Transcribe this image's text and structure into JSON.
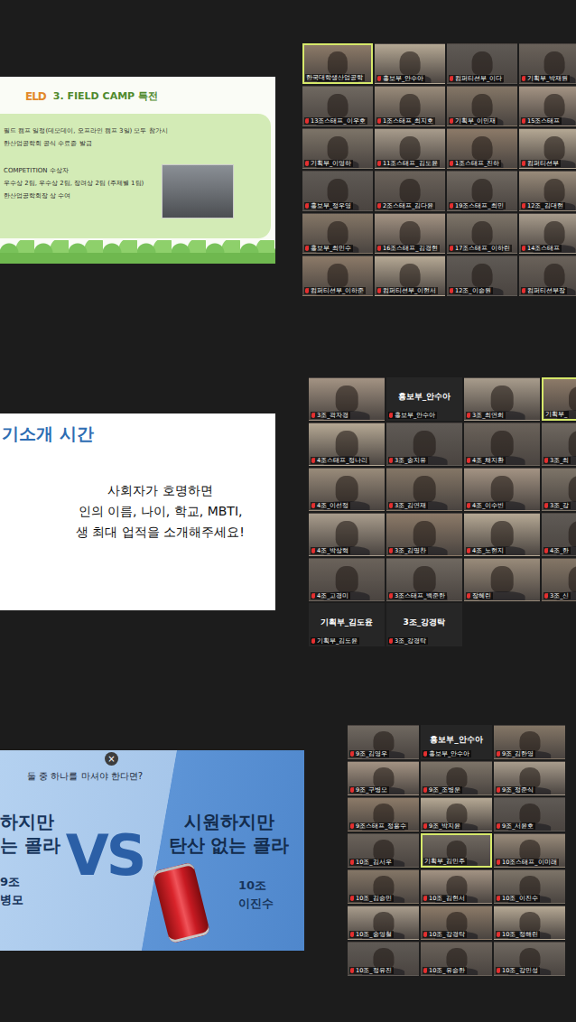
{
  "sections": [
    {
      "slide": {
        "kind": "benefits",
        "logo": "ELD",
        "title": "3. FIELD CAMP 특전",
        "lines": [
          "필드 캠프 일정(데모데이, 오프라인 캠프 3일) 모두 참가시",
          "한산업공학회 공식 수료증 발급"
        ],
        "lines2": [
          "COMPETITION 수상자",
          "우수상 2팀, 우수상 2팀, 장려상 2팀 (주제별 1팀)",
          "한산업공학회장 상 수여"
        ]
      },
      "grid": {
        "columns": 4,
        "tiles": [
          {
            "kind": "video",
            "label": "한국대학생산업공학",
            "muted": false,
            "active": true
          },
          {
            "kind": "video",
            "label": "홍보부_안수아",
            "muted": true,
            "active": false
          },
          {
            "kind": "video",
            "label": "컴퍼티션부_이다",
            "muted": true,
            "active": false
          },
          {
            "kind": "video",
            "label": "기획부_박재원",
            "muted": true,
            "active": false
          },
          {
            "kind": "video",
            "label": "13조스태프_이우호",
            "muted": true,
            "active": false
          },
          {
            "kind": "video",
            "label": "1조스태프_최지호",
            "muted": true,
            "active": false
          },
          {
            "kind": "video",
            "label": "기획부_이민재",
            "muted": true,
            "active": false
          },
          {
            "kind": "video",
            "label": "15조스태프",
            "muted": true,
            "active": false
          },
          {
            "kind": "video",
            "label": "기획부_이영하",
            "muted": true,
            "active": false
          },
          {
            "kind": "video",
            "label": "11조스태프_김도윤",
            "muted": true,
            "active": false
          },
          {
            "kind": "video",
            "label": "1조스태프_진하",
            "muted": true,
            "active": false
          },
          {
            "kind": "video",
            "label": "컴퍼티션부",
            "muted": true,
            "active": false
          },
          {
            "kind": "video",
            "label": "홍보부_정우영",
            "muted": true,
            "active": false
          },
          {
            "kind": "video",
            "label": "2조스태프_김다윤",
            "muted": true,
            "active": false
          },
          {
            "kind": "video",
            "label": "19조스태프_최민",
            "muted": true,
            "active": false
          },
          {
            "kind": "video",
            "label": "12조_김대현",
            "muted": true,
            "active": false
          },
          {
            "kind": "video",
            "label": "홍보부_최민수",
            "muted": true,
            "active": false
          },
          {
            "kind": "video",
            "label": "16조스태프_김경현",
            "muted": true,
            "active": false
          },
          {
            "kind": "video",
            "label": "17조스태프_이하린",
            "muted": true,
            "active": false
          },
          {
            "kind": "video",
            "label": "14조스태프",
            "muted": true,
            "active": false
          },
          {
            "kind": "video",
            "label": "컴퍼티션부_이하준",
            "muted": true,
            "active": false
          },
          {
            "kind": "video",
            "label": "컴퍼티션부_이현서",
            "muted": true,
            "active": false
          },
          {
            "kind": "video",
            "label": "12조_이승원",
            "muted": true,
            "active": false
          },
          {
            "kind": "video",
            "label": "컴퍼티션부장",
            "muted": true,
            "active": false
          }
        ]
      }
    },
    {
      "slide": {
        "kind": "intro",
        "title": "기소개 시간",
        "lines": [
          "사회자가 호명하면",
          "인의 이름, 나이, 학교,  MBTI,",
          "생 최대 업적을 소개해주세요!"
        ]
      },
      "grid": {
        "columns": 4,
        "tiles": [
          {
            "kind": "video",
            "label": "3조_곽자경",
            "muted": true,
            "active": false
          },
          {
            "kind": "name",
            "name": "홍보부_안수아",
            "label": "홍보부_안수아",
            "muted": true,
            "active": false
          },
          {
            "kind": "video",
            "label": "3조_최연희",
            "muted": true,
            "active": false
          },
          {
            "kind": "video",
            "label": "기획부_",
            "muted": false,
            "active": true
          },
          {
            "kind": "video",
            "label": "4조스태프_정나리",
            "muted": true,
            "active": false
          },
          {
            "kind": "video",
            "label": "3조_송지유",
            "muted": true,
            "active": false
          },
          {
            "kind": "video",
            "label": "4조_채지환",
            "muted": true,
            "active": false
          },
          {
            "kind": "video",
            "label": "3조_최",
            "muted": true,
            "active": false
          },
          {
            "kind": "video",
            "label": "4조_이선정",
            "muted": true,
            "active": false
          },
          {
            "kind": "video",
            "label": "3조_김연재",
            "muted": true,
            "active": false
          },
          {
            "kind": "video",
            "label": "4조_이수빈",
            "muted": true,
            "active": false
          },
          {
            "kind": "video",
            "label": "3조_강",
            "muted": true,
            "active": false
          },
          {
            "kind": "video",
            "label": "4조_박상혁",
            "muted": true,
            "active": false
          },
          {
            "kind": "video",
            "label": "3조_김명찬",
            "muted": true,
            "active": false
          },
          {
            "kind": "video",
            "label": "4조_노현지",
            "muted": true,
            "active": false
          },
          {
            "kind": "video",
            "label": "4조_한",
            "muted": true,
            "active": false
          },
          {
            "kind": "video",
            "label": "4조_고경미",
            "muted": true,
            "active": false
          },
          {
            "kind": "video",
            "label": "3조스태프_백준한",
            "muted": true,
            "active": false
          },
          {
            "kind": "video",
            "label": "장혜린",
            "muted": true,
            "active": false
          },
          {
            "kind": "video",
            "label": "3조_신",
            "muted": true,
            "active": false
          },
          {
            "kind": "name",
            "name": "기획부_김도윤",
            "label": "기획부_김도윤",
            "muted": true,
            "active": false
          },
          {
            "kind": "name",
            "name": "3조_강경탁",
            "label": "3조_강경탁",
            "muted": true,
            "active": false
          }
        ]
      }
    },
    {
      "slide": {
        "kind": "versus",
        "question": "둘 중 하나를 마셔야 한다면?",
        "close": "×",
        "left": {
          "lines": [
            "하지만",
            "는 콜라"
          ],
          "team": "9조",
          "person": "병모"
        },
        "vs": "VS",
        "right": {
          "lines": [
            "시원하지만",
            "탄산 없는 콜라"
          ],
          "team": "10조",
          "person": "이진수"
        }
      },
      "grid": {
        "columns": 3,
        "tiles": [
          {
            "kind": "video",
            "label": "9조_김영우",
            "muted": true,
            "active": false
          },
          {
            "kind": "name",
            "name": "홍보부_안수아",
            "label": "홍보부_안수아",
            "muted": true,
            "active": false
          },
          {
            "kind": "video",
            "label": "9조_김한영",
            "muted": true,
            "active": false
          },
          {
            "kind": "video",
            "label": "9조_구병모",
            "muted": true,
            "active": false
          },
          {
            "kind": "video",
            "label": "9조_조병운",
            "muted": true,
            "active": false
          },
          {
            "kind": "video",
            "label": "9조_정준식",
            "muted": true,
            "active": false
          },
          {
            "kind": "video",
            "label": "9조스태프_정용수",
            "muted": true,
            "active": false
          },
          {
            "kind": "video",
            "label": "9조_박지윤",
            "muted": true,
            "active": false
          },
          {
            "kind": "video",
            "label": "9조_서윤호",
            "muted": true,
            "active": false
          },
          {
            "kind": "video",
            "label": "10조_김서우",
            "muted": true,
            "active": false
          },
          {
            "kind": "video",
            "label": "기획부_김민주",
            "muted": false,
            "active": true
          },
          {
            "kind": "video",
            "label": "10조스태프_이미래",
            "muted": true,
            "active": false
          },
          {
            "kind": "video",
            "label": "10조_김승민",
            "muted": true,
            "active": false
          },
          {
            "kind": "video",
            "label": "10조_김현서",
            "muted": true,
            "active": false
          },
          {
            "kind": "video",
            "label": "10조_이진수",
            "muted": true,
            "active": false
          },
          {
            "kind": "video",
            "label": "10조_송영철",
            "muted": true,
            "active": false
          },
          {
            "kind": "video",
            "label": "10조_강경탁",
            "muted": true,
            "active": false
          },
          {
            "kind": "video",
            "label": "10조_정해린",
            "muted": true,
            "active": false
          },
          {
            "kind": "video",
            "label": "10조_정유진",
            "muted": true,
            "active": false
          },
          {
            "kind": "video",
            "label": "10조_유승한",
            "muted": true,
            "active": false
          },
          {
            "kind": "video",
            "label": "10조_강민성",
            "muted": true,
            "active": false
          }
        ]
      }
    }
  ]
}
